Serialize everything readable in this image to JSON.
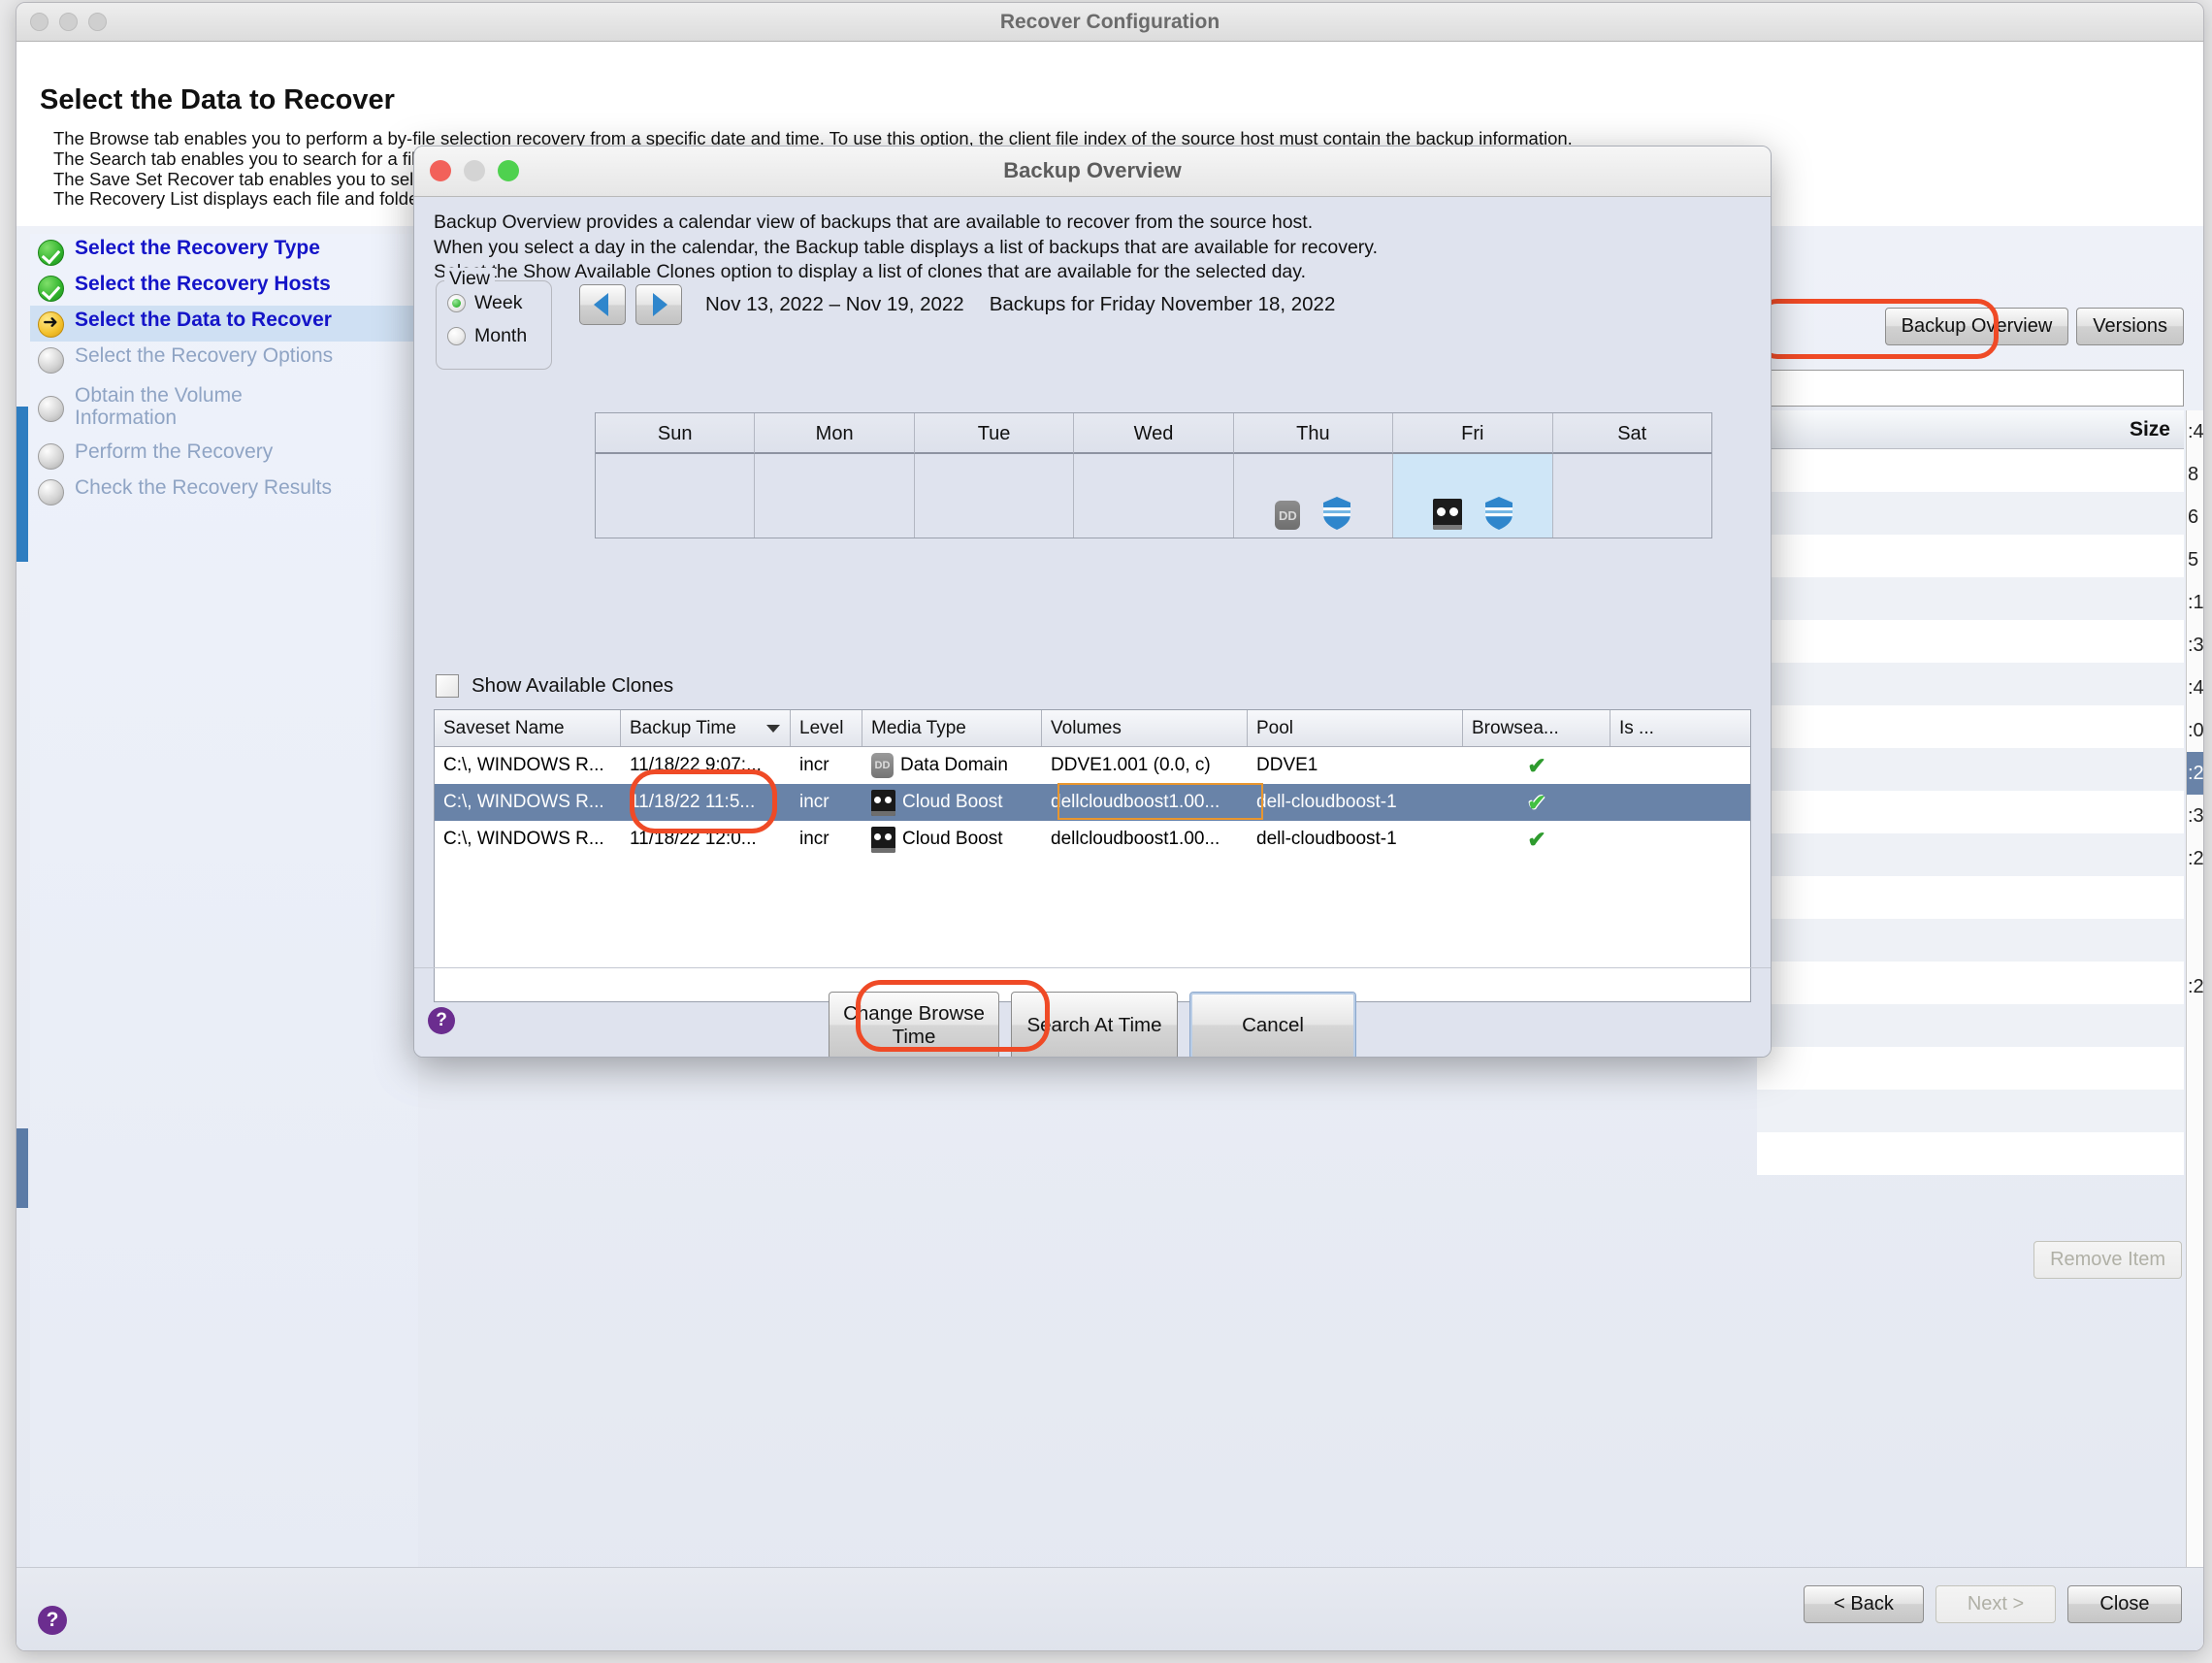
{
  "main_window": {
    "title": "Recover Configuration",
    "page_title": "Select the Data to Recover",
    "description_lines": [
      "The Browse tab enables you to perform a by-file selection recovery from a specific date and time. To use this option, the client file index of the source host must contain the backup information.",
      "The Search tab enables you to search for a file by name. To use this option, the client file index of the source host must contain the backup information.",
      "The Save Set Recover tab enables you to select save sets to recover. To use this option, the media database of the source host must contain backup information.",
      "The Recovery List displays each file and folder marked for recovery."
    ],
    "steps": [
      {
        "label": "Select the Recovery Type",
        "state": "done"
      },
      {
        "label": "Select the Recovery Hosts",
        "state": "done"
      },
      {
        "label": "Select the Data to Recover",
        "state": "current"
      },
      {
        "label": "Select the Recovery Options",
        "state": "todo"
      },
      {
        "label": "Obtain the Volume Information",
        "state": "todo"
      },
      {
        "label": "Perform the Recovery",
        "state": "todo"
      },
      {
        "label": "Check the Recovery Results",
        "state": "todo"
      }
    ],
    "overview_button": "Backup Overview",
    "versions_button": "Versions",
    "size_column_header": "Size",
    "remove_item_button": "Remove Item",
    "footer_buttons": [
      {
        "label": "< Back",
        "enabled": true
      },
      {
        "label": "Next >",
        "enabled": false
      },
      {
        "label": "Close",
        "enabled": true
      }
    ],
    "help_icon": "help-icon",
    "far_right_values": [
      ":4",
      "8",
      "6",
      "5",
      ":1",
      ":3",
      ":4",
      ":0",
      ":2",
      ":3",
      ":2",
      "",
      "",
      ":2"
    ]
  },
  "dialog": {
    "title": "Backup Overview",
    "traffic_lights": [
      "close-button",
      "minimize-button",
      "zoom-button"
    ],
    "intro_lines": [
      "Backup Overview provides a calendar view of backups that are available to recover from the source host.",
      "When you select a day in the calendar, the Backup table displays a list of backups that are available for recovery.",
      "Select the Show Available Clones option to display a list of clones that are available for the selected day."
    ],
    "view": {
      "legend": "View",
      "options": [
        {
          "label": "Week",
          "selected": true
        },
        {
          "label": "Month",
          "selected": false
        }
      ]
    },
    "nav": {
      "prev_icon": "left-arrow-icon",
      "next_icon": "right-arrow-icon",
      "date_range": "Nov 13, 2022 – Nov 19, 2022",
      "backups_for": "Backups for Friday November 18, 2022"
    },
    "calendar": {
      "day_headers": [
        "Sun",
        "Mon",
        "Tue",
        "Wed",
        "Thu",
        "Fri",
        "Sat"
      ],
      "cells": [
        {
          "day": "Sun",
          "selected": false,
          "icons": []
        },
        {
          "day": "Mon",
          "selected": false,
          "icons": []
        },
        {
          "day": "Tue",
          "selected": false,
          "icons": []
        },
        {
          "day": "Wed",
          "selected": false,
          "icons": []
        },
        {
          "day": "Thu",
          "selected": false,
          "icons": [
            "data-domain-icon",
            "clone-shield-icon"
          ]
        },
        {
          "day": "Fri",
          "selected": true,
          "icons": [
            "cloud-boost-tape-icon",
            "clone-shield-icon"
          ]
        },
        {
          "day": "Sat",
          "selected": false,
          "icons": []
        }
      ]
    },
    "show_clones": {
      "label": "Show Available Clones",
      "checked": false
    },
    "table": {
      "columns": [
        "Saveset Name",
        "Backup Time",
        "Level",
        "Media Type",
        "Volumes",
        "Pool",
        "Browsea...",
        "Is ..."
      ],
      "sorted_column": "Backup Time",
      "rows": [
        {
          "saveset": "C:\\, WINDOWS R...",
          "time": "11/18/22 9:07:...",
          "level": "incr",
          "media_icon": "data-domain-icon",
          "media": "Data Domain",
          "volumes": "DDVE1.001 (0.0, c)",
          "pool": "DDVE1",
          "browseable": "✔",
          "is": "",
          "selected": false
        },
        {
          "saveset": "C:\\, WINDOWS R...",
          "time": "11/18/22 11:5...",
          "level": "incr",
          "media_icon": "cloud-boost-tape-icon",
          "media": "Cloud Boost",
          "volumes": "dellcloudboost1.00...",
          "pool": "dell-cloudboost-1",
          "browseable": "✔",
          "is": "",
          "selected": true
        },
        {
          "saveset": "C:\\, WINDOWS R...",
          "time": "11/18/22 12:0...",
          "level": "incr",
          "media_icon": "cloud-boost-tape-icon",
          "media": "Cloud Boost",
          "volumes": "dellcloudboost1.00...",
          "pool": "dell-cloudboost-1",
          "browseable": "✔",
          "is": "",
          "selected": false
        }
      ]
    },
    "footer_buttons": [
      {
        "label": "Change Browse Time",
        "highlighted": true
      },
      {
        "label": "Search At Time",
        "highlighted": false
      },
      {
        "label": "Cancel",
        "highlighted": false,
        "default": true
      }
    ],
    "help_icon": "help-icon"
  },
  "highlights": {
    "color": "#ef4a26",
    "orange_box_color": "#e8962f",
    "targets": [
      "Backup Overview",
      "Cloud Boost media type cell",
      "Change Browse Time"
    ]
  }
}
